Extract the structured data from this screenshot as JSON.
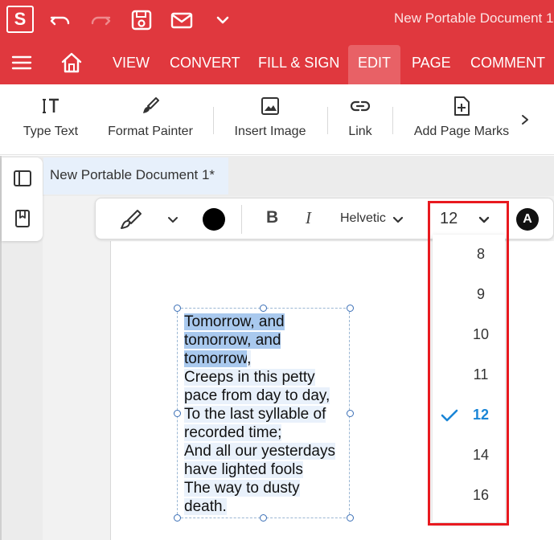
{
  "titlebar": {
    "logo": "S",
    "document_title": "New Portable Document 1",
    "icons": [
      "undo-icon",
      "redo-icon",
      "save-icon",
      "mail-icon",
      "chevron-down-icon"
    ]
  },
  "menu": {
    "tabs": [
      "VIEW",
      "CONVERT",
      "FILL & SIGN",
      "EDIT",
      "PAGE",
      "COMMENT"
    ],
    "active_tab": "EDIT"
  },
  "ribbon": {
    "tools": [
      "Type Text",
      "Format Painter",
      "Insert Image",
      "Link",
      "Add Page Marks"
    ]
  },
  "document": {
    "tab_label": "New Portable Document 1*"
  },
  "format_toolbar": {
    "text_color": "#000000",
    "bold_label": "B",
    "italic_label": "I",
    "font_name": "Helvetic",
    "font_size": "12",
    "badge_label": "A"
  },
  "font_size_dropdown": {
    "options": [
      "8",
      "9",
      "10",
      "11",
      "12",
      "14",
      "16"
    ],
    "selected": "12",
    "accent_color": "#1a85d6",
    "highlight_color": "#e8191f"
  },
  "textbox": {
    "lines": [
      {
        "selected": "Tomorrow, and",
        "rest": ""
      },
      {
        "selected": "tomorrow, and",
        "rest": ""
      },
      {
        "selected": "tomorrow",
        "rest": ","
      },
      {
        "selected": "",
        "rest": "Creeps in this petty"
      },
      {
        "selected": "",
        "rest": "pace from day to day,"
      },
      {
        "selected": "",
        "rest": "To the last syllable of"
      },
      {
        "selected": "",
        "rest": "recorded time;"
      },
      {
        "selected": "",
        "rest": "And all our yesterdays"
      },
      {
        "selected": "",
        "rest": "have lighted fools"
      },
      {
        "selected": "",
        "rest": "The way to dusty"
      },
      {
        "selected": "",
        "rest": "death."
      }
    ]
  },
  "colors": {
    "brand_red": "#e0383e",
    "active_tab_bg": "#e86166"
  }
}
